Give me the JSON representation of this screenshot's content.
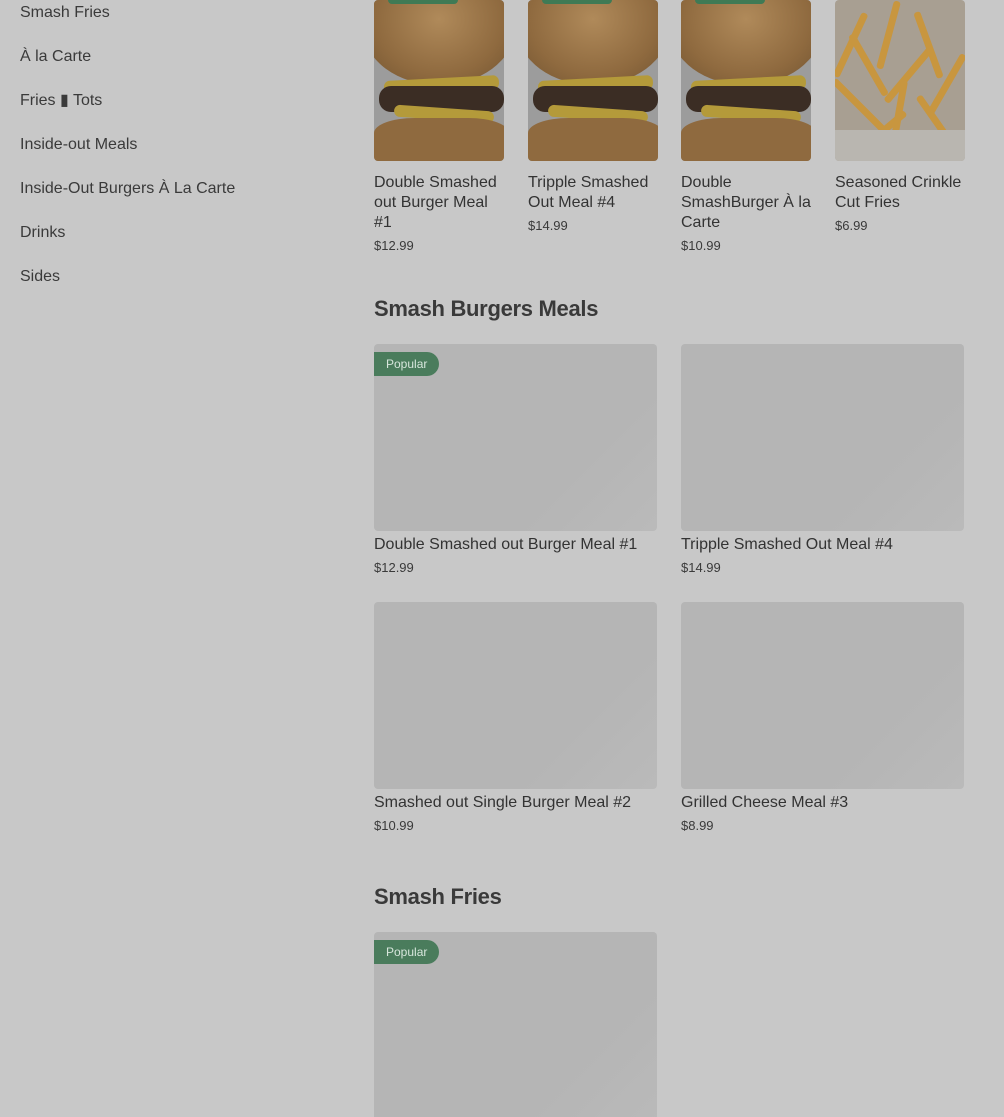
{
  "sidebar": {
    "items": [
      {
        "label": "Smash Fries"
      },
      {
        "label": "À la Carte"
      },
      {
        "label": "Fries ▮ Tots"
      },
      {
        "label": "Inside-out Meals"
      },
      {
        "label": "Inside-Out Burgers À La Carte"
      },
      {
        "label": "Drinks"
      },
      {
        "label": "Sides"
      }
    ]
  },
  "carousel": {
    "items": [
      {
        "title": "Double Smashed out Burger Meal #1",
        "price": "$12.99",
        "image": "burger-photo"
      },
      {
        "title": "Tripple Smashed Out Meal #4",
        "price": "$14.99",
        "image": "burger-photo"
      },
      {
        "title": "Double SmashBurger À la Carte",
        "price": "$10.99",
        "image": "burger-photo"
      },
      {
        "title": "Seasoned Crinkle Cut Fries",
        "price": "$6.99",
        "image": "fries-photo"
      }
    ]
  },
  "sections": [
    {
      "title": "Smash Burgers Meals",
      "items": [
        {
          "title": "Double Smashed out Burger Meal #1",
          "price": "$12.99",
          "badge": "Popular"
        },
        {
          "title": "Tripple Smashed Out Meal #4",
          "price": "$14.99"
        },
        {
          "title": "Smashed out Single Burger Meal #2",
          "price": "$10.99"
        },
        {
          "title": "Grilled Cheese Meal #3",
          "price": "$8.99"
        }
      ]
    },
    {
      "title": "Smash Fries",
      "items": [
        {
          "badge": "Popular"
        }
      ]
    }
  ],
  "colors": {
    "overlay_bg": "#c8c8c8",
    "badge_green": "#4a7c5c",
    "placeholder": "#b5b5b5"
  }
}
